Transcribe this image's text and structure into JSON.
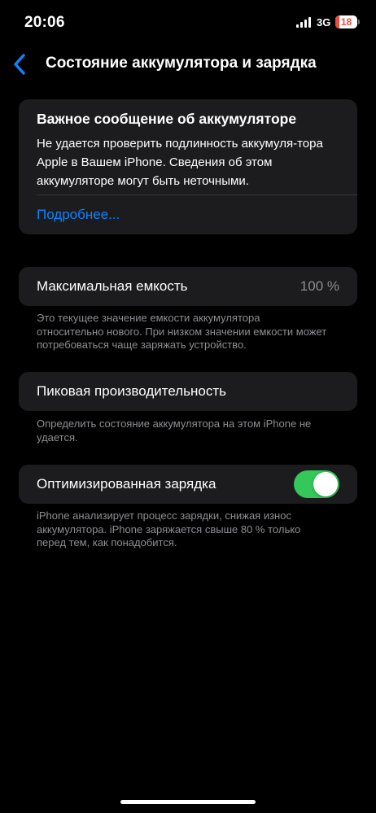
{
  "status_bar": {
    "time": "20:06",
    "network": "3G",
    "battery_level": "18",
    "battery_fraction": 0.18,
    "icons": [
      "signal-bars-icon",
      "battery-icon"
    ]
  },
  "nav": {
    "back_icon": "chevron-left-icon",
    "title": "Состояние аккумулятора и зарядка"
  },
  "alert": {
    "title": "Важное сообщение об аккумуляторе",
    "body": "Не удается проверить подлинность аккумуля-тора Apple в Вашем iPhone. Сведения об этом аккумуляторе могут быть неточными.",
    "link": "Подробнее..."
  },
  "capacity": {
    "label": "Максимальная емкость",
    "value": "100 %",
    "footnote": "Это текущее значение емкости аккумулятора относительно нового. При низком значении емкости может потребоваться чаще заряжать устройство."
  },
  "performance": {
    "label": "Пиковая производительность",
    "footnote": "Определить состояние аккумулятора на этом iPhone не удается."
  },
  "optimized": {
    "label": "Оптимизированная зарядка",
    "enabled": true,
    "footnote": "iPhone анализирует процесс зарядки, снижая износ аккумулятора. iPhone заряжается свыше 80 % только перед тем, как понадобится."
  },
  "colors": {
    "accent": "#0a84ff",
    "toggle_on": "#34c759",
    "battery_low": "#eb4d3d",
    "card_bg": "#1c1c1e",
    "secondary_text": "#8e8e93"
  }
}
